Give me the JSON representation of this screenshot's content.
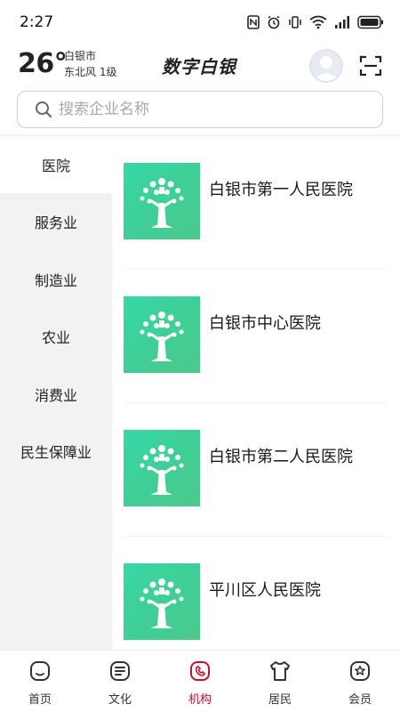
{
  "status": {
    "time": "2:27"
  },
  "header": {
    "temperature": "26°",
    "city": "白银市",
    "wind": "东北风  1级",
    "app_title": "数字白银"
  },
  "search": {
    "placeholder": "搜索企业名称"
  },
  "sidebar": {
    "items": [
      {
        "label": "医院",
        "active": true
      },
      {
        "label": "服务业"
      },
      {
        "label": "制造业"
      },
      {
        "label": "农业"
      },
      {
        "label": "消费业"
      },
      {
        "label": "民生保障业"
      }
    ]
  },
  "orgs": [
    {
      "name": "白银市第一人民医院"
    },
    {
      "name": "白银市中心医院"
    },
    {
      "name": "白银市第二人民医院"
    },
    {
      "name": "平川区人民医院"
    }
  ],
  "bottom_nav": {
    "items": [
      {
        "label": "首页",
        "icon": "home-icon"
      },
      {
        "label": "文化",
        "icon": "culture-icon"
      },
      {
        "label": "机构",
        "icon": "institution-icon",
        "active": true
      },
      {
        "label": "居民",
        "icon": "resident-icon"
      },
      {
        "label": "会员",
        "icon": "member-icon"
      }
    ]
  },
  "colors": {
    "accent": "#c8102e",
    "thumb_green": "#3fcf96",
    "sidebar_bg": "#f2f2f2"
  }
}
